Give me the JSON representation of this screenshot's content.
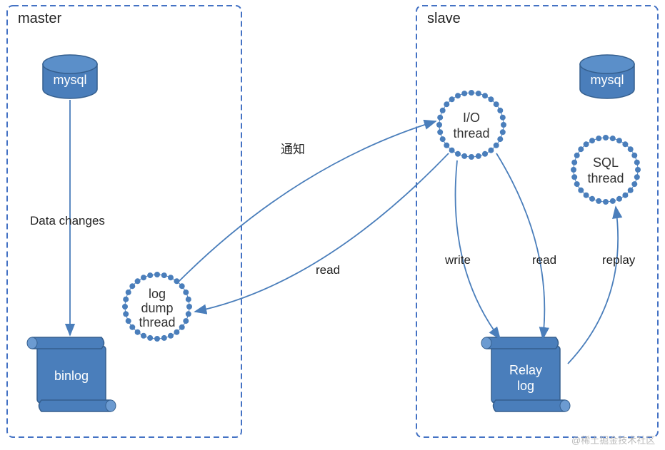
{
  "diagram": {
    "containers": {
      "master": {
        "title": "master"
      },
      "slave": {
        "title": "slave"
      }
    },
    "nodes": {
      "master_mysql": {
        "label": "mysql"
      },
      "binlog": {
        "label": "binlog"
      },
      "log_dump_thread": {
        "line1": "log",
        "line2": "dump",
        "line3": "thread"
      },
      "io_thread": {
        "line1": "I/O",
        "line2": "thread"
      },
      "sql_thread": {
        "line1": "SQL",
        "line2": "thread"
      },
      "slave_mysql": {
        "label": "mysql"
      },
      "relay_log": {
        "line1": "Relay",
        "line2": "log"
      }
    },
    "edges": {
      "data_changes": {
        "label": "Data changes"
      },
      "notify": {
        "label": "通知"
      },
      "read_dump": {
        "label": "read"
      },
      "write": {
        "label": "write"
      },
      "read_relay": {
        "label": "read"
      },
      "replay": {
        "label": "replay"
      }
    },
    "watermark": "@稀土掘金技术社区"
  }
}
